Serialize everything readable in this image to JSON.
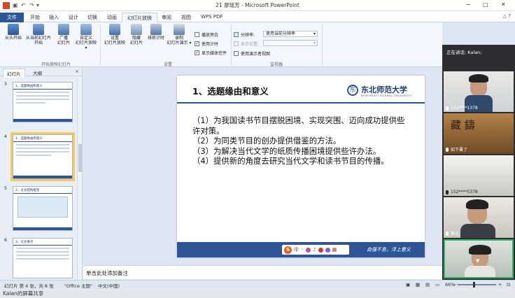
{
  "window": {
    "title": "21 廖瑶芳 - Microsoft PowerPoint",
    "controls": [
      "−",
      "□",
      "✕"
    ]
  },
  "ribbon_tabs": [
    "文件",
    "开始",
    "插入",
    "设计",
    "切换",
    "动画",
    "幻灯片放映",
    "审阅",
    "视图",
    "WPS PDF"
  ],
  "ribbon": {
    "start_group_buttons": [
      {
        "label1": "从头开始",
        "label2": ""
      },
      {
        "label1": "从当前幻灯片",
        "label2": "开始"
      },
      {
        "label1": "广播",
        "label2": "幻灯片"
      },
      {
        "label1": "自定义",
        "label2": "幻灯片放映 ▾"
      }
    ],
    "start_group_label": "开始放映幻灯片",
    "setup_buttons": [
      {
        "label1": "设置",
        "label2": "幻灯片放映"
      },
      {
        "label1": "隐藏",
        "label2": "幻灯片"
      },
      {
        "label1": "排练计时",
        "label2": ""
      },
      {
        "label1": "录制",
        "label2": "幻灯片演示 ▾"
      }
    ],
    "setup_checks": [
      {
        "label": "播放旁白",
        "checked": false
      },
      {
        "label": "使用计时",
        "checked": true
      },
      {
        "label": "显示媒体控件",
        "checked": true
      }
    ],
    "setup_group_label": "设置",
    "monitor": {
      "resolution_label": "分辨率:",
      "resolution_value": "使用当前分辨率",
      "show_on_label": "显示位置:",
      "presenter_view_label": "使用演示者视图",
      "group_label": "监视器"
    },
    "help_icons": "△ ?"
  },
  "left_pane": {
    "tabs": [
      "幻灯片",
      "大纲"
    ],
    "close": "×",
    "slides": [
      {
        "num": "3",
        "title": "1、选题缘由和意义"
      },
      {
        "num": "4",
        "title": "1、选题缘由和意义"
      },
      {
        "num": "5",
        "title": "2、论文结构框架"
      },
      {
        "num": "6",
        "title": "3、论文要点"
      }
    ]
  },
  "slide": {
    "title": "1、选题缘由和意义",
    "logo_text": "东北师范大学",
    "logo_mark": "东",
    "logo_en": "NORTHEAST NORMAL UNIVERSITY",
    "body": [
      "（1）为我国读书节目摆脱困境、实现突围、迈向成功提供些许对策。",
      "（2）为同类节目的创办提供借鉴的方法。",
      "（3）为解决当代文学的纸质传播困境提供些许办法。",
      "（4）提供新的角度去研究当代文学和读书节目的传播。"
    ],
    "motto": "自强不息，浮上意义"
  },
  "input_toolbar": {
    "logo": "S",
    "label": "中"
  },
  "notes_placeholder": "单击此处添加备注",
  "status": {
    "slide_info": "幻灯片 第 4 张，共 8 张",
    "theme": "\"Office 主题\"",
    "language": "中文(中国)",
    "zoom": "66%"
  },
  "share_bar": {
    "text": "Kalan的屏幕共享"
  },
  "participants": {
    "header": "正在讲话: Kalan;",
    "feeds": [
      {
        "name": "152****1378"
      },
      {
        "name": "如下蚤了"
      },
      {
        "name": "152****5378"
      },
      {
        "name": "崔兆"
      },
      {
        "name": ""
      }
    ]
  },
  "colors": {
    "accent": "#2e5596",
    "file_tab": "#2b5797",
    "selected_thumb": "#f5c95c"
  }
}
